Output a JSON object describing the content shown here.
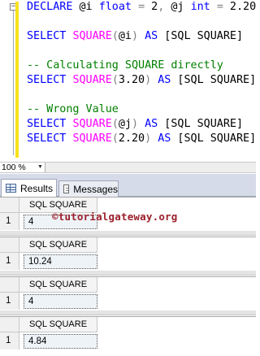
{
  "editor": {
    "lines": [
      [
        {
          "t": "DECLARE",
          "c": "kw"
        },
        {
          "t": " @i ",
          "c": "pl"
        },
        {
          "t": "float",
          "c": "kw"
        },
        {
          "t": " ",
          "c": "pl"
        },
        {
          "t": "=",
          "c": "op"
        },
        {
          "t": " 2",
          "c": "pl"
        },
        {
          "t": ",",
          "c": "op"
        },
        {
          "t": " @j ",
          "c": "pl"
        },
        {
          "t": "int",
          "c": "kw"
        },
        {
          "t": " ",
          "c": "pl"
        },
        {
          "t": "=",
          "c": "op"
        },
        {
          "t": " 2.20",
          "c": "pl"
        }
      ],
      [],
      [
        {
          "t": "SELECT",
          "c": "kw"
        },
        {
          "t": " ",
          "c": "pl"
        },
        {
          "t": "SQUARE",
          "c": "fn"
        },
        {
          "t": "(",
          "c": "op"
        },
        {
          "t": "@i",
          "c": "pl"
        },
        {
          "t": ")",
          "c": "op"
        },
        {
          "t": " ",
          "c": "pl"
        },
        {
          "t": "AS",
          "c": "kw"
        },
        {
          "t": " [SQL SQUARE]",
          "c": "pl"
        }
      ],
      [],
      [
        {
          "t": "-- Calculating SQUARE directly",
          "c": "cm"
        }
      ],
      [
        {
          "t": "SELECT",
          "c": "kw"
        },
        {
          "t": " ",
          "c": "pl"
        },
        {
          "t": "SQUARE",
          "c": "fn"
        },
        {
          "t": "(",
          "c": "op"
        },
        {
          "t": "3.20",
          "c": "pl"
        },
        {
          "t": ")",
          "c": "op"
        },
        {
          "t": " ",
          "c": "pl"
        },
        {
          "t": "AS",
          "c": "kw"
        },
        {
          "t": " [SQL SQUARE]",
          "c": "pl"
        }
      ],
      [],
      [
        {
          "t": "-- Wrong Value",
          "c": "cm"
        }
      ],
      [
        {
          "t": "SELECT",
          "c": "kw"
        },
        {
          "t": " ",
          "c": "pl"
        },
        {
          "t": "SQUARE",
          "c": "fn"
        },
        {
          "t": "(",
          "c": "op"
        },
        {
          "t": "@j",
          "c": "pl"
        },
        {
          "t": ")",
          "c": "op"
        },
        {
          "t": " ",
          "c": "pl"
        },
        {
          "t": "AS",
          "c": "kw"
        },
        {
          "t": " [SQL SQUARE]",
          "c": "pl"
        }
      ],
      [
        {
          "t": "SELECT",
          "c": "kw"
        },
        {
          "t": " ",
          "c": "pl"
        },
        {
          "t": "SQUARE",
          "c": "fn"
        },
        {
          "t": "(",
          "c": "op"
        },
        {
          "t": "2.20",
          "c": "pl"
        },
        {
          "t": ")",
          "c": "op"
        },
        {
          "t": " ",
          "c": "pl"
        },
        {
          "t": "AS",
          "c": "kw"
        },
        {
          "t": " [SQL SQUARE]",
          "c": "pl"
        }
      ]
    ],
    "collapse_glyph": "−",
    "colors": {
      "keyword": "#0000ff",
      "function": "#ff00ff",
      "comment": "#008000",
      "operator": "#808080",
      "change_bar": "#f7e21e"
    }
  },
  "zoom": {
    "value": "100 %",
    "arrow": "▼"
  },
  "tabs": [
    {
      "label": "Results",
      "icon": "results-grid-icon"
    },
    {
      "label": "Messages",
      "icon": "messages-icon"
    }
  ],
  "watermark": "©tutorialgateway.org",
  "result_grids": [
    {
      "column": "SQL SQUARE",
      "row_number": "1",
      "value": "4"
    },
    {
      "column": "SQL SQUARE",
      "row_number": "1",
      "value": "10.24"
    },
    {
      "column": "SQL SQUARE",
      "row_number": "1",
      "value": "4"
    },
    {
      "column": "SQL SQUARE",
      "row_number": "1",
      "value": "4.84"
    }
  ]
}
